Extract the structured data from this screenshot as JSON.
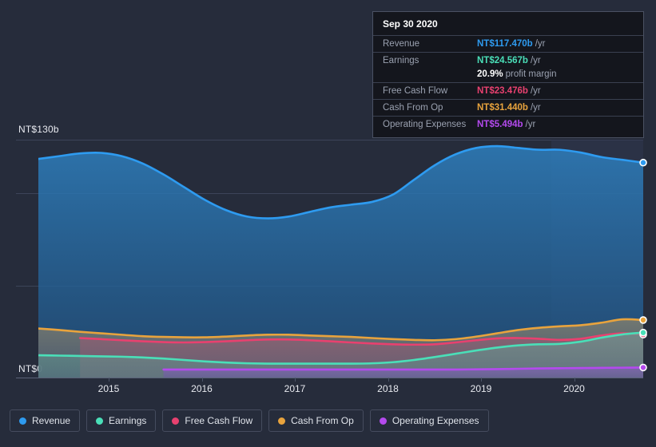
{
  "axis": {
    "y_top_label": "NT$130b",
    "y_bottom_label": "NT$0",
    "x_ticks": [
      "2015",
      "2016",
      "2017",
      "2018",
      "2019",
      "2020"
    ]
  },
  "tooltip": {
    "date": "Sep 30 2020",
    "rows": [
      {
        "key": "Revenue",
        "value": "NT$117.470b",
        "unit": "/yr",
        "color": "#2e9bf0"
      },
      {
        "key": "Earnings",
        "value": "NT$24.567b",
        "unit": "/yr",
        "color": "#4adfb8"
      },
      {
        "key": "",
        "value": "20.9%",
        "unit": "profit margin",
        "color": "#ffffff"
      },
      {
        "key": "Free Cash Flow",
        "value": "NT$23.476b",
        "unit": "/yr",
        "color": "#e8416f"
      },
      {
        "key": "Cash From Op",
        "value": "NT$31.440b",
        "unit": "/yr",
        "color": "#e8a33d"
      },
      {
        "key": "Operating Expenses",
        "value": "NT$5.494b",
        "unit": "/yr",
        "color": "#b44aee"
      }
    ]
  },
  "legend": [
    {
      "label": "Revenue",
      "color": "#2e9bf0"
    },
    {
      "label": "Earnings",
      "color": "#4adfb8"
    },
    {
      "label": "Free Cash Flow",
      "color": "#e8416f"
    },
    {
      "label": "Cash From Op",
      "color": "#e8a33d"
    },
    {
      "label": "Operating Expenses",
      "color": "#b44aee"
    }
  ],
  "chart_data": {
    "type": "area",
    "title": "",
    "xlabel": "",
    "ylabel": "NT$b",
    "ylim": [
      0,
      130
    ],
    "grid": true,
    "legend_position": "bottom",
    "x_tick_years": [
      2015,
      2016,
      2017,
      2018,
      2019,
      2020
    ],
    "currency": "NT$",
    "units": "billions per year",
    "highlight_point": {
      "date": "Sep 30 2020",
      "revenue": 117.47,
      "earnings": 24.567,
      "free_cash_flow": 23.476,
      "cash_from_op": 31.44,
      "operating_expenses": 5.494,
      "profit_margin_pct": 20.9
    },
    "series": [
      {
        "name": "Revenue",
        "color": "#2e9bf0",
        "values": [
          119.5,
          121.0,
          122.5,
          122.8,
          121.0,
          117.0,
          111.0,
          104.0,
          97.0,
          91.5,
          88.0,
          87.0,
          88.0,
          90.5,
          93.0,
          94.5,
          96.0,
          100.0,
          108.0,
          116.0,
          122.0,
          125.5,
          126.5,
          125.5,
          124.5,
          124.5,
          123.0,
          120.5,
          119.0,
          117.47
        ]
      },
      {
        "name": "Cash From Op",
        "color": "#e8a33d",
        "values": [
          26.8,
          26.0,
          25.0,
          24.2,
          23.4,
          22.6,
          22.2,
          22.0,
          22.0,
          22.4,
          23.0,
          23.4,
          23.4,
          23.0,
          22.6,
          22.2,
          21.6,
          21.0,
          20.6,
          20.4,
          21.0,
          22.4,
          24.2,
          26.0,
          27.2,
          28.0,
          28.6,
          30.0,
          31.8,
          31.44
        ]
      },
      {
        "name": "Free Cash Flow",
        "color": "#e8416f",
        "values": [
          null,
          null,
          21.6,
          21.0,
          20.4,
          19.8,
          19.4,
          19.2,
          19.4,
          19.8,
          20.4,
          20.8,
          20.8,
          20.4,
          19.8,
          19.2,
          18.6,
          18.2,
          18.0,
          18.2,
          19.2,
          20.4,
          21.4,
          21.6,
          21.2,
          20.6,
          21.2,
          23.0,
          24.2,
          23.476
        ]
      },
      {
        "name": "Earnings",
        "color": "#4adfb8",
        "values": [
          12.2,
          12.0,
          11.8,
          11.6,
          11.4,
          11.0,
          10.4,
          9.6,
          8.8,
          8.2,
          7.8,
          7.6,
          7.6,
          7.6,
          7.6,
          7.6,
          7.8,
          8.4,
          9.6,
          11.2,
          13.0,
          14.8,
          16.4,
          17.6,
          18.2,
          18.4,
          19.6,
          21.8,
          23.6,
          24.567
        ]
      },
      {
        "name": "Operating Expenses",
        "color": "#b44aee",
        "values": [
          null,
          null,
          null,
          null,
          null,
          null,
          4.4,
          4.4,
          4.4,
          4.4,
          4.4,
          4.4,
          4.4,
          4.4,
          4.4,
          4.4,
          4.4,
          4.4,
          4.4,
          4.4,
          4.4,
          4.5,
          4.6,
          4.8,
          5.0,
          5.1,
          5.2,
          5.3,
          5.4,
          5.494
        ]
      }
    ]
  }
}
